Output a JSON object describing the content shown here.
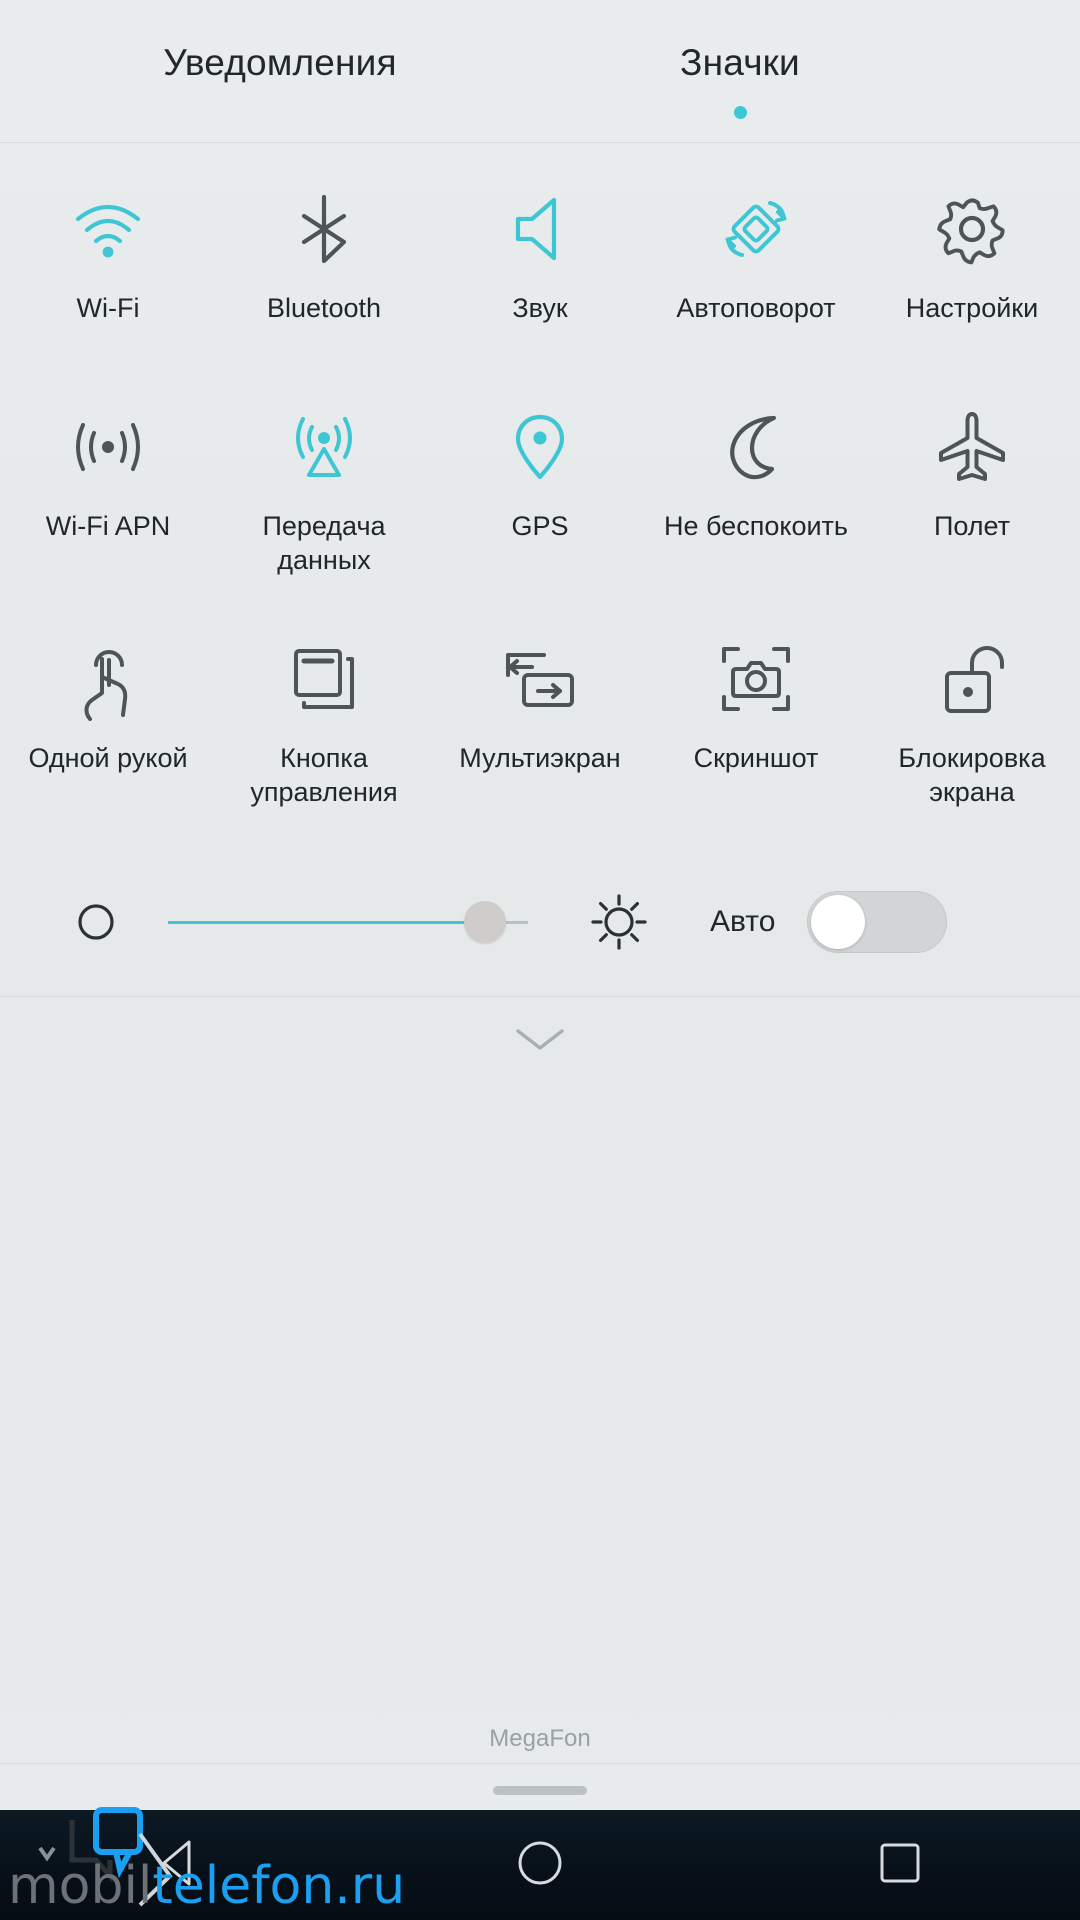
{
  "colors": {
    "active": "#3fc6d4",
    "inactive": "#4d5558",
    "background": "#e7ebeb",
    "text": "#20262a",
    "accent_dot": "#3fc6d4",
    "navbar": "#071019"
  },
  "tabs": {
    "notifications": {
      "label": "Уведомления",
      "active": false
    },
    "icons": {
      "label": "Значки",
      "active": true
    }
  },
  "tiles": {
    "row1": [
      {
        "label": "Wi-Fi",
        "icon": "wifi-icon",
        "active": true
      },
      {
        "label": "Bluetooth",
        "icon": "bluetooth-icon",
        "active": false
      },
      {
        "label": "Звук",
        "icon": "sound-icon",
        "active": true
      },
      {
        "label": "Автоповорот",
        "icon": "auto-rotate-icon",
        "active": true
      },
      {
        "label": "Настройки",
        "icon": "settings-gear-icon",
        "active": false
      }
    ],
    "row2": [
      {
        "label": "Wi-Fi APN",
        "icon": "hotspot-icon",
        "active": false
      },
      {
        "label": "Передача\nданных",
        "icon": "mobile-data-icon",
        "active": true
      },
      {
        "label": "GPS",
        "icon": "location-pin-icon",
        "active": true
      },
      {
        "label": "Не беспокоить",
        "icon": "moon-icon",
        "active": false
      },
      {
        "label": "Полет",
        "icon": "airplane-icon",
        "active": false
      }
    ],
    "row3": [
      {
        "label": "Одной рукой",
        "icon": "one-hand-icon",
        "active": false
      },
      {
        "label": "Кнопка\nуправления",
        "icon": "nav-button-icon",
        "active": false
      },
      {
        "label": "Мультиэкран",
        "icon": "multiscreen-icon",
        "active": false
      },
      {
        "label": "Скриншот",
        "icon": "screenshot-camera-icon",
        "active": false
      },
      {
        "label": "Блокировка\nэкрана",
        "icon": "screen-lock-icon",
        "active": false
      }
    ]
  },
  "brightness": {
    "low_icon": "brightness-low-icon",
    "high_icon": "brightness-high-icon",
    "value_percent": 88,
    "auto_label": "Авто",
    "auto_enabled": false
  },
  "expand": {
    "icon": "chevron-down-icon"
  },
  "status": {
    "carrier": "MegaFon"
  },
  "navbar": {
    "back": "back-triangle-icon",
    "home": "home-circle-icon",
    "recents": "recents-square-icon"
  },
  "watermark": {
    "part1": "mobil",
    "part2": "telefon",
    "part3": ".ru"
  }
}
